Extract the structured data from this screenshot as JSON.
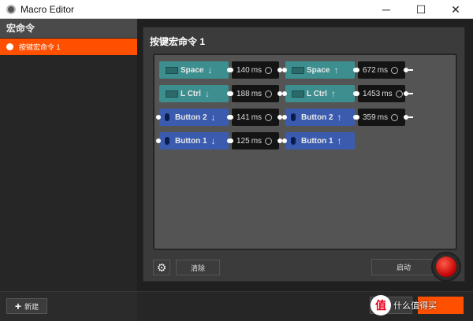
{
  "window": {
    "title": "Macro Editor",
    "minimize": "─",
    "maximize": "☐",
    "close": "✕"
  },
  "sidebar": {
    "header": "宏命令",
    "items": [
      {
        "label": "按键宏命令 1",
        "selected": true
      }
    ],
    "new_button": "新建"
  },
  "panel": {
    "title": "按键宏命令 1",
    "clear_button": "清除",
    "start_button": "启动"
  },
  "macro": {
    "rows": [
      [
        {
          "kind": "key",
          "label": "Space",
          "dir": "down"
        },
        {
          "kind": "delay",
          "value": "140",
          "unit": "ms"
        },
        {
          "kind": "key",
          "label": "Space",
          "dir": "up"
        },
        {
          "kind": "delay",
          "value": "672",
          "unit": "ms"
        }
      ],
      [
        {
          "kind": "key",
          "label": "L Ctrl",
          "dir": "down"
        },
        {
          "kind": "delay",
          "value": "188",
          "unit": "ms"
        },
        {
          "kind": "key",
          "label": "L Ctrl",
          "dir": "up"
        },
        {
          "kind": "delay",
          "value": "1453",
          "unit": "ms"
        }
      ],
      [
        {
          "kind": "mouse",
          "label": "Button 2",
          "dir": "down"
        },
        {
          "kind": "delay",
          "value": "141",
          "unit": "ms"
        },
        {
          "kind": "mouse",
          "label": "Button 2",
          "dir": "up"
        },
        {
          "kind": "delay",
          "value": "359",
          "unit": "ms"
        }
      ],
      [
        {
          "kind": "mouse",
          "label": "Button 1",
          "dir": "down"
        },
        {
          "kind": "delay",
          "value": "125",
          "unit": "ms"
        },
        {
          "kind": "mouse",
          "label": "Button 1",
          "dir": "up"
        }
      ]
    ]
  },
  "watermark": {
    "badge": "值",
    "text": "什么值得买"
  },
  "colors": {
    "accent": "#ff5000",
    "key_block": "#3d8e8e",
    "mouse_block": "#3b5cae",
    "delay_block": "#141414"
  }
}
